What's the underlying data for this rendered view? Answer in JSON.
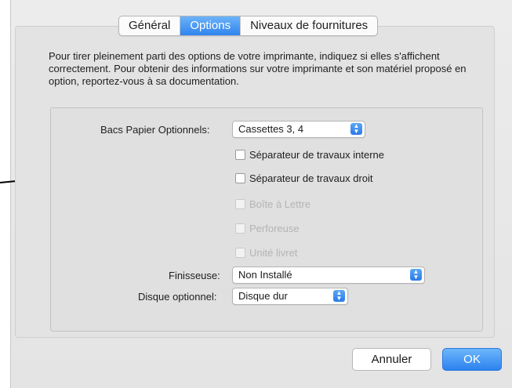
{
  "tabs": [
    {
      "label": "Général",
      "active": false
    },
    {
      "label": "Options",
      "active": true
    },
    {
      "label": "Niveaux de fournitures",
      "active": false
    }
  ],
  "intro": "Pour tirer pleinement parti des options de votre imprimante, indiquez si elles s'affichent correctement. Pour obtenir des informations sur votre imprimante et son matériel proposé en option, reportez-vous à sa documentation.",
  "fields": {
    "trays": {
      "label": "Bacs Papier Optionnels:",
      "value": "Cassettes 3, 4"
    },
    "finisher": {
      "label": "Finisseuse:",
      "value": "Non Installé"
    },
    "disk": {
      "label": "Disque optionnel:",
      "value": "Disque dur"
    }
  },
  "checkboxes": [
    {
      "label": "Séparateur de travaux interne",
      "checked": false,
      "enabled": true
    },
    {
      "label": "Séparateur de travaux droit",
      "checked": false,
      "enabled": true
    },
    {
      "label": "Boîte à Lettre",
      "checked": false,
      "enabled": false
    },
    {
      "label": "Perforeuse",
      "checked": false,
      "enabled": false
    },
    {
      "label": "Unité livret",
      "checked": false,
      "enabled": false
    }
  ],
  "buttons": {
    "cancel": "Annuler",
    "ok": "OK"
  },
  "colors": {
    "accent": "#2f84ee",
    "pane": "#e3e3e3",
    "disabled_text": "#b4b4b4"
  },
  "icons": {
    "popup": "up-down-chevron-icon",
    "pointer": "arrow-icon"
  }
}
